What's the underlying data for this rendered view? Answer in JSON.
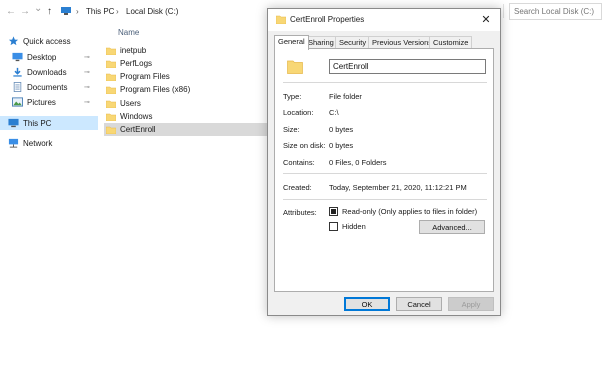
{
  "explorer": {
    "nav_back": "←",
    "nav_forward": "→",
    "nav_recent": "⌄",
    "nav_up": "↑",
    "breadcrumb": [
      "This PC",
      "Local Disk (C:)"
    ],
    "breadcrumb_sep": "›",
    "search_placeholder": "Search Local Disk (C:)",
    "sidebar": [
      {
        "label": "Quick access",
        "icon": "star-icon"
      },
      {
        "label": "Desktop",
        "icon": "desktop-icon",
        "pinned": true
      },
      {
        "label": "Downloads",
        "icon": "download-icon",
        "pinned": true
      },
      {
        "label": "Documents",
        "icon": "documents-icon",
        "pinned": true
      },
      {
        "label": "Pictures",
        "icon": "pictures-icon",
        "pinned": true
      },
      {
        "label": "This PC",
        "icon": "computer-icon",
        "selected": true
      },
      {
        "label": "Network",
        "icon": "network-icon"
      }
    ],
    "pin_glyph": "📌",
    "column_name": "Name",
    "files": [
      "inetpub",
      "PerfLogs",
      "Program Files",
      "Program Files (x86)",
      "Users",
      "Windows",
      "CertEnroll"
    ],
    "selected_file": "CertEnroll"
  },
  "dialog": {
    "title": "CertEnroll Properties",
    "close_glyph": "✕",
    "tabs": [
      "General",
      "Sharing",
      "Security",
      "Previous Versions",
      "Customize"
    ],
    "active_tab": "General",
    "folder_name": "CertEnroll",
    "properties": {
      "type_label": "Type:",
      "type_value": "File folder",
      "location_label": "Location:",
      "location_value": "C:\\",
      "size_label": "Size:",
      "size_value": "0 bytes",
      "size_on_disk_label": "Size on disk:",
      "size_on_disk_value": "0 bytes",
      "contains_label": "Contains:",
      "contains_value": "0 Files, 0 Folders",
      "created_label": "Created:",
      "created_value": "Today, September 21, 2020, 11:12:21 PM",
      "attributes_label": "Attributes:"
    },
    "attributes": {
      "readonly_label": "Read-only (Only applies to files in folder)",
      "readonly_state": "indeterminate",
      "hidden_label": "Hidden",
      "hidden_state": "unchecked",
      "advanced_label": "Advanced..."
    },
    "buttons": {
      "ok": "OK",
      "cancel": "Cancel",
      "apply": "Apply"
    }
  },
  "colors": {
    "folder": "#f8d775",
    "folder_dark": "#e6b84a",
    "selection": "#cce8ff",
    "accent": "#0078d7"
  }
}
